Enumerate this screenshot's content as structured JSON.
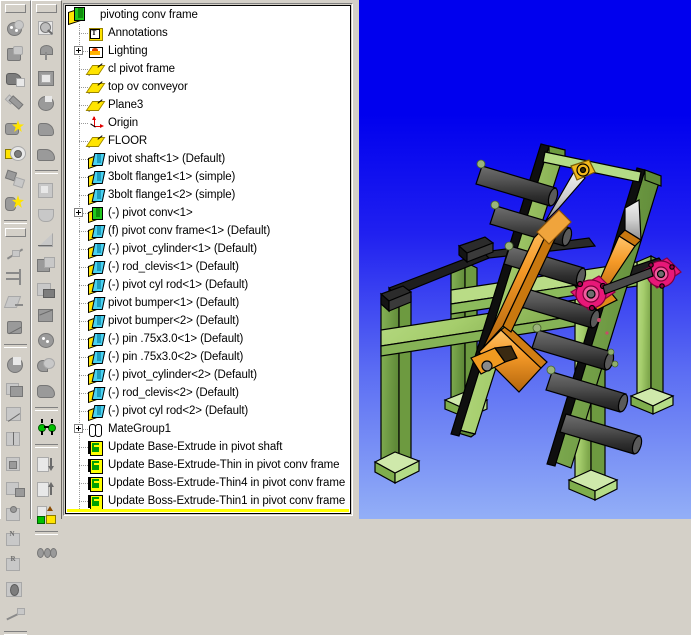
{
  "app": {
    "title": "pivoting conv frame",
    "background_top_color": "#0000ee",
    "background_bottom_color": "#93aff7"
  },
  "toolbars": {
    "left": {
      "name": "assembly-tools-toolbar",
      "groups": [
        {
          "items": [
            {
              "label": "Edit Part",
              "icon": "edit-part-icon",
              "enabled": false
            },
            {
              "label": "Insert Component",
              "icon": "insert-component-icon",
              "enabled": false
            },
            {
              "label": "Hide/Show Component",
              "icon": "hide-show-component-icon",
              "enabled": false
            },
            {
              "label": "Change Suppression State",
              "icon": "suppression-state-icon",
              "enabled": false
            },
            {
              "label": "New Part",
              "icon": "new-part-icon",
              "enabled": true
            },
            {
              "label": "Edit Assembly",
              "icon": "edit-assembly-icon",
              "enabled": true
            },
            {
              "label": "Explode View",
              "icon": "explode-view-icon",
              "enabled": false
            },
            {
              "label": "Smart Fasteners",
              "icon": "smart-fasteners-icon",
              "enabled": true
            }
          ]
        },
        {
          "items": [
            {
              "label": "Point",
              "icon": "point-icon",
              "enabled": false
            },
            {
              "label": "Axis",
              "icon": "axis-icon",
              "enabled": false
            },
            {
              "label": "Coordinate System",
              "icon": "coordinate-system-icon",
              "enabled": false
            },
            {
              "label": "Measure",
              "icon": "measure-icon",
              "enabled": false
            }
          ]
        },
        {
          "items": [
            {
              "label": "Section View",
              "icon": "section-view-icon",
              "enabled": false
            },
            {
              "label": "Reference Geometry",
              "icon": "reference-geometry-icon",
              "enabled": false
            },
            {
              "label": "Curve",
              "icon": "curve-icon",
              "enabled": false
            },
            {
              "label": "Split Line",
              "icon": "split-line-icon",
              "enabled": false
            },
            {
              "label": "Projected Curve",
              "icon": "projected-curve-icon",
              "enabled": false
            },
            {
              "label": "Composite Curve",
              "icon": "composite-curve-icon",
              "enabled": false
            },
            {
              "label": "Helix and Spiral",
              "icon": "helix-icon",
              "enabled": false
            },
            {
              "label": "Curve Through XYZ Points",
              "icon": "curve-xyz-icon",
              "enabled": false
            },
            {
              "label": "Curve Through Reference Points",
              "icon": "curve-ref-icon",
              "enabled": false
            },
            {
              "label": "Dome",
              "icon": "dome-icon",
              "enabled": false
            },
            {
              "label": "Shape",
              "icon": "shape-icon",
              "enabled": false
            }
          ]
        }
      ]
    },
    "right": {
      "name": "view-tools-toolbar",
      "groups": [
        {
          "items": [
            {
              "label": "Zoom to Fit",
              "icon": "zoom-to-fit-icon",
              "enabled": false
            },
            {
              "label": "Zoom to Area",
              "icon": "zoom-to-area-icon",
              "enabled": false
            },
            {
              "label": "Zoom In/Out",
              "icon": "zoom-in-out-icon",
              "enabled": false
            },
            {
              "label": "Rotate View",
              "icon": "rotate-view-icon",
              "enabled": false
            },
            {
              "label": "Pan",
              "icon": "pan-icon",
              "enabled": false
            },
            {
              "label": "Previous View",
              "icon": "previous-view-icon",
              "enabled": false
            }
          ]
        },
        {
          "items": [
            {
              "label": "Wireframe",
              "icon": "wireframe-icon",
              "enabled": false
            },
            {
              "label": "Hidden Lines Visible",
              "icon": "hidden-lines-visible-icon",
              "enabled": false
            },
            {
              "label": "Hidden Lines Removed",
              "icon": "hidden-lines-removed-icon",
              "enabled": false
            },
            {
              "label": "Shaded",
              "icon": "shaded-icon",
              "enabled": false
            },
            {
              "label": "Shadows In Shaded Mode",
              "icon": "shadows-icon",
              "enabled": false
            },
            {
              "label": "Section View",
              "icon": "section-view-icon",
              "enabled": false
            },
            {
              "label": "Perspective",
              "icon": "perspective-icon",
              "enabled": false
            }
          ]
        },
        {
          "items": [
            {
              "label": "Move Component",
              "icon": "move-component-icon",
              "enabled": true
            }
          ]
        },
        {
          "items": [
            {
              "label": "Move Down",
              "icon": "move-down-icon",
              "enabled": false
            },
            {
              "label": "Move Up",
              "icon": "move-up-icon",
              "enabled": false
            },
            {
              "label": "Replace Component",
              "icon": "replace-component-icon",
              "enabled": true
            }
          ]
        },
        {
          "items": [
            {
              "label": "Simulation",
              "icon": "simulation-icon",
              "enabled": false
            }
          ]
        }
      ]
    }
  },
  "feature_tree": {
    "name": "feature-manager-design-tree",
    "rows": [
      {
        "label": "pivoting conv frame",
        "icon": "assembly-icon",
        "depth": 0,
        "expander": "none"
      },
      {
        "label": "Annotations",
        "icon": "annotations-icon",
        "depth": 1,
        "expander": "none"
      },
      {
        "label": "Lighting",
        "icon": "lighting-icon",
        "depth": 1,
        "expander": "plus"
      },
      {
        "label": "cl pivot frame",
        "icon": "plane-icon",
        "depth": 1,
        "expander": "none"
      },
      {
        "label": "top ov conveyor",
        "icon": "plane-icon",
        "depth": 1,
        "expander": "none"
      },
      {
        "label": "Plane3",
        "icon": "plane-icon",
        "depth": 1,
        "expander": "none"
      },
      {
        "label": "Origin",
        "icon": "origin-icon",
        "depth": 1,
        "expander": "none"
      },
      {
        "label": "FLOOR",
        "icon": "plane-icon",
        "depth": 1,
        "expander": "none"
      },
      {
        "label": "pivot shaft<1> (Default)",
        "icon": "part-icon",
        "depth": 1,
        "expander": "none"
      },
      {
        "label": "3bolt flange1<1> (simple)",
        "icon": "part-icon",
        "depth": 1,
        "expander": "none"
      },
      {
        "label": "3bolt flange1<2> (simple)",
        "icon": "part-icon",
        "depth": 1,
        "expander": "none"
      },
      {
        "label": "(-) pivot conv<1>",
        "icon": "subassembly-icon",
        "depth": 1,
        "expander": "plus"
      },
      {
        "label": "(f) pivot conv frame<1> (Default)",
        "icon": "part-icon",
        "depth": 1,
        "expander": "none"
      },
      {
        "label": "(-) pivot_cylinder<1> (Default)",
        "icon": "part-icon",
        "depth": 1,
        "expander": "none"
      },
      {
        "label": "(-) rod_clevis<1> (Default)",
        "icon": "part-icon",
        "depth": 1,
        "expander": "none"
      },
      {
        "label": "(-) pivot cyl rod<1> (Default)",
        "icon": "part-icon",
        "depth": 1,
        "expander": "none"
      },
      {
        "label": "pivot bumper<1> (Default)",
        "icon": "part-icon",
        "depth": 1,
        "expander": "none"
      },
      {
        "label": "pivot bumper<2> (Default)",
        "icon": "part-icon",
        "depth": 1,
        "expander": "none"
      },
      {
        "label": "(-) pin .75x3.0<1> (Default)",
        "icon": "part-icon",
        "depth": 1,
        "expander": "none"
      },
      {
        "label": "(-) pin .75x3.0<2> (Default)",
        "icon": "part-icon",
        "depth": 1,
        "expander": "none"
      },
      {
        "label": "(-) pivot_cylinder<2> (Default)",
        "icon": "part-icon",
        "depth": 1,
        "expander": "none"
      },
      {
        "label": "(-) rod_clevis<2> (Default)",
        "icon": "part-icon",
        "depth": 1,
        "expander": "none"
      },
      {
        "label": "(-) pivot cyl rod<2> (Default)",
        "icon": "part-icon",
        "depth": 1,
        "expander": "none"
      },
      {
        "label": "MateGroup1",
        "icon": "mategroup-icon",
        "depth": 1,
        "expander": "plus"
      },
      {
        "label": "Update Base-Extrude in pivot shaft",
        "icon": "update-icon",
        "depth": 1,
        "expander": "none"
      },
      {
        "label": "Update Base-Extrude-Thin in pivot conv frame",
        "icon": "update-icon",
        "depth": 1,
        "expander": "none"
      },
      {
        "label": "Update Boss-Extrude-Thin4 in pivot conv frame",
        "icon": "update-icon",
        "depth": 1,
        "expander": "none"
      },
      {
        "label": "Update Boss-Extrude-Thin1 in pivot conv frame",
        "icon": "update-icon",
        "depth": 1,
        "expander": "none"
      }
    ]
  },
  "viewport": {
    "name": "graphics-viewport",
    "model_name": "pivoting conv frame",
    "colors": {
      "frame_green": "#a8cf70",
      "roller_gray": "#4a4a4a",
      "cylinder_orange": "#f59a28",
      "rod_silver": "#d8d8d8",
      "flange_magenta": "#e81878",
      "bumper_black": "#1c1c1c",
      "clevis_yellow": "#f2b81c"
    }
  }
}
